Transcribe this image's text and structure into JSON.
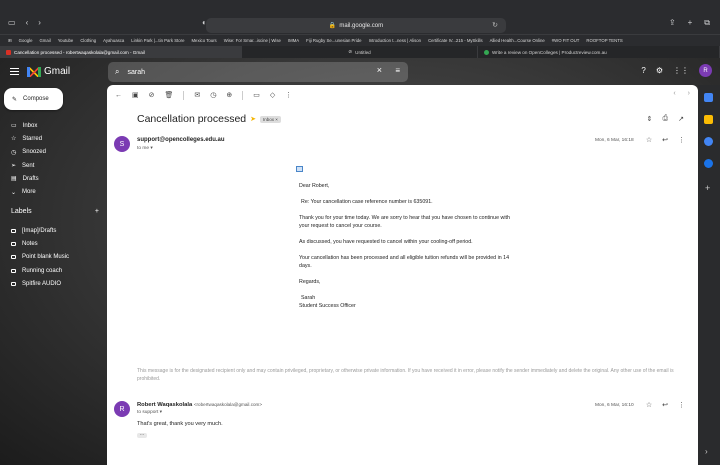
{
  "browser": {
    "url": "mail.google.com",
    "bookmarks": [
      "Google",
      "Gmail",
      "Youtube",
      "Clothing",
      "Ayahuasca",
      "Linkin Park |...tin Park Store",
      "Mexico Tours",
      "Wise: For Smar...iscine | Wise",
      "IMMA",
      "Fiji Rugby Se...unesian Pride",
      "Introduction t...ness | Alison",
      "Certificate IV...215 - MySkills",
      "Allied Health...Course Online",
      "#WO FIT OUT",
      "ROOFTOP TENTS"
    ],
    "tabs": [
      {
        "title": "Cancellation processed - robertwaqaskolala@gmail.com - Gmail",
        "active": true
      },
      {
        "title": "Untitled",
        "active": false
      },
      {
        "title": "Write a review on OpenColleges | Productreview.com.au",
        "active": false
      }
    ]
  },
  "gmail": {
    "app_name": "Gmail",
    "search_value": "sarah",
    "avatar_letter": "R",
    "compose_label": "Compose",
    "nav": [
      "Inbox",
      "Starred",
      "Snoozed",
      "Sent",
      "Drafts",
      "More"
    ],
    "labels_header": "Labels",
    "labels": [
      "[Imap]/Drafts",
      "Notes",
      "Point blank Music",
      "Running coach",
      "Spitfire AUDIO"
    ]
  },
  "thread": {
    "subject": "Cancellation processed",
    "chip": "Inbox",
    "message1": {
      "avatar": "S",
      "from": "support@opencolleges.edu.au",
      "to": "to me",
      "date": "Mon, 6 Mar, 16:18",
      "greeting": "Dear Robert,",
      "p1": "Re: Your cancellation case reference number is 635091.",
      "p2": "Thank you for your time today. We are sorry to hear that you have chosen to continue with your request to cancel your course.",
      "p3": "As discussed, you have requested to cancel within your cooling-off period.",
      "p4": "Your cancellation has been processed and all eligible tuition refunds will be provided in 14 days.",
      "closing": "Regards,",
      "sig_name": "Sarah",
      "sig_title": "Student Success Officer",
      "disclaimer": "This message is for the designated recipient only and may contain privileged, proprietary, or otherwise private information. If you have received it in error, please notify the sender immediately and delete the original. Any other use of the email is prohibited."
    },
    "message2": {
      "avatar": "R",
      "from_name": "Robert Waqaskolala",
      "from_email": "<robertwaqaskolala@gmail.com>",
      "to": "to support",
      "date": "Mon, 6 Mar, 16:10",
      "body": "That's great, thank you very much."
    }
  }
}
